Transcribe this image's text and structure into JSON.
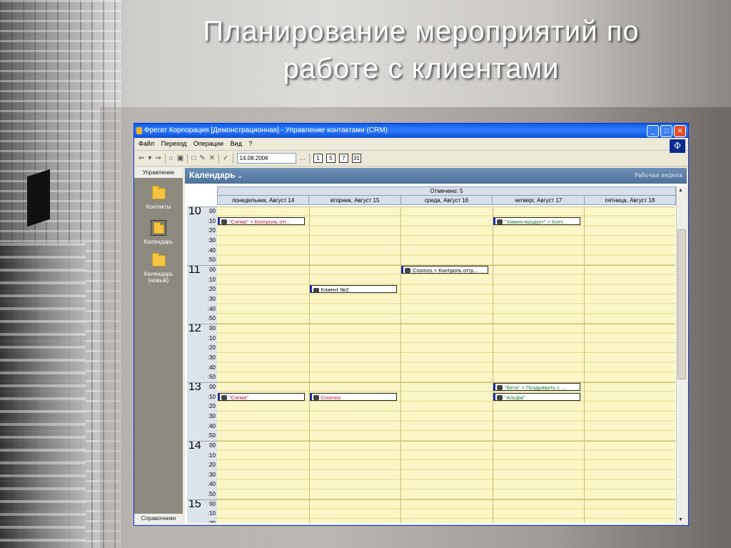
{
  "slide": {
    "title_line1": "Планирование мероприятий по",
    "title_line2": "работе с клиентами"
  },
  "window": {
    "title": "Фрегат Корпорация [Демонстрационная] - Управление контактами (CRM)",
    "controls": [
      "_",
      "□",
      "✕"
    ]
  },
  "menu": [
    "Файл",
    "Переход",
    "Операции",
    "Вид",
    "?"
  ],
  "toolbar": {
    "date": "14.08.2006",
    "date_btn": "...",
    "views": [
      "1",
      "5",
      "7",
      "31"
    ]
  },
  "sidebar": {
    "header": "Управление",
    "items": [
      {
        "label": "Контакты",
        "icon": "folder-icon"
      },
      {
        "label": "Календарь",
        "icon": "folder-icon"
      },
      {
        "label": "Календарь (новый)",
        "icon": "folder-icon"
      }
    ],
    "footer": "Справочники"
  },
  "calendar": {
    "title": "Календарь",
    "view_mode": "Рабочая неделя",
    "marked": "Отмечено: 5",
    "days": [
      "понедельник, Август 14",
      "вторник, Август 15",
      "среда, Август 16",
      "четверг, Август 17",
      "пятница, Август 18"
    ],
    "hours": [
      "10",
      "11",
      "12",
      "13",
      "14",
      "15"
    ],
    "minutes": [
      "00",
      ":10",
      ":20",
      ":30",
      ":40",
      ":50"
    ],
    "events": [
      {
        "day": 0,
        "slot": 1,
        "text": "\"Сигма\" > Контроль отг...",
        "color": "#b0132b"
      },
      {
        "day": 3,
        "slot": 1,
        "text": "\"Химия-продукт\" > Конт...",
        "color": "#1a7a2a"
      },
      {
        "day": 2,
        "slot": 6,
        "text": "Cosmos > Контроль отгр...",
        "color": "#000000"
      },
      {
        "day": 1,
        "slot": 8,
        "text": "Клиент №2",
        "color": "#000000"
      },
      {
        "day": 3,
        "slot": 18,
        "text": "\"Бета\" > Поздравить с ...",
        "color": "#1a7a2a"
      },
      {
        "day": 0,
        "slot": 19,
        "text": "\"Сигма\"",
        "color": "#b0132b"
      },
      {
        "day": 1,
        "slot": 19,
        "text": "Cosmos",
        "color": "#b0132b"
      },
      {
        "day": 3,
        "slot": 19,
        "text": "\"Альфа\"",
        "color": "#1a7a2a"
      }
    ]
  }
}
